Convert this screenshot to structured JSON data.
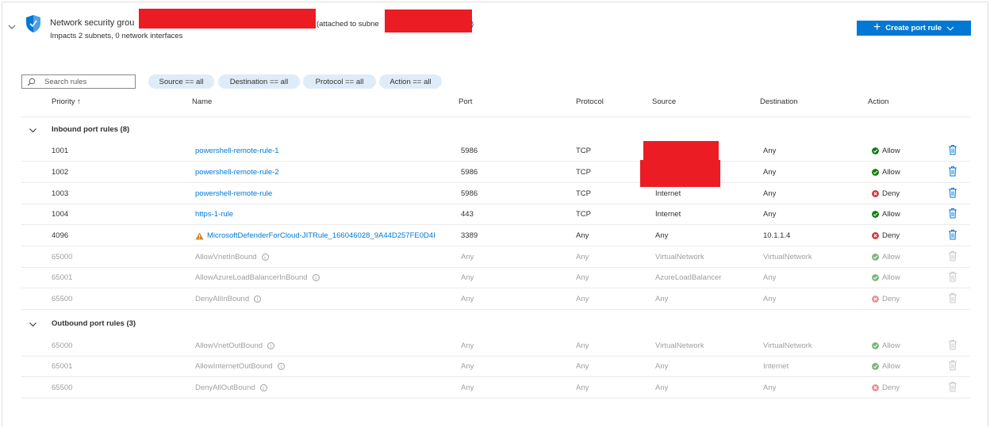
{
  "header": {
    "title": "Network security grou",
    "attached_prefix": "(attached to subne",
    "attached_suffix": ")",
    "subtitle": "Impacts 2 subnets, 0 network interfaces",
    "create_button": "Create port rule"
  },
  "colors": {
    "accent": "#0078d4",
    "allow": "#107c10",
    "deny": "#d13438",
    "pill_bg": "#deecf9",
    "redaction": "#ec1c24"
  },
  "filters": {
    "search_placeholder": "Search rules",
    "pills": [
      "Source == all",
      "Destination == all",
      "Protocol == all",
      "Action == all"
    ]
  },
  "columns": {
    "priority": "Priority ↑",
    "name": "Name",
    "port": "Port",
    "protocol": "Protocol",
    "source": "Source",
    "destination": "Destination",
    "action": "Action"
  },
  "inbound": {
    "label": "Inbound port rules (8)",
    "rows": [
      {
        "priority": "1001",
        "name": "powershell-remote-rule-1",
        "port": "5986",
        "protocol": "TCP",
        "source": "",
        "destination": "Any",
        "action": "Allow"
      },
      {
        "priority": "1002",
        "name": "powershell-remote-rule-2",
        "port": "5986",
        "protocol": "TCP",
        "source": "",
        "destination": "Any",
        "action": "Allow"
      },
      {
        "priority": "1003",
        "name": "powershell-remote-rule",
        "port": "5986",
        "protocol": "TCP",
        "source": "Internet",
        "destination": "Any",
        "action": "Deny"
      },
      {
        "priority": "1004",
        "name": "https-1-rule",
        "port": "443",
        "protocol": "TCP",
        "source": "Internet",
        "destination": "Any",
        "action": "Allow"
      },
      {
        "priority": "4096",
        "name": "MicrosoftDefenderForCloud-JITRule_166046028_9A44D257FE0D4I",
        "port": "3389",
        "protocol": "Any",
        "source": "Any",
        "destination": "10.1.1.4",
        "action": "Deny"
      },
      {
        "priority": "65000",
        "name": "AllowVnetInBound",
        "port": "Any",
        "protocol": "Any",
        "source": "VirtualNetwork",
        "destination": "VirtualNetwork",
        "action": "Allow"
      },
      {
        "priority": "65001",
        "name": "AllowAzureLoadBalancerInBound",
        "port": "Any",
        "protocol": "Any",
        "source": "AzureLoadBalancer",
        "destination": "Any",
        "action": "Allow"
      },
      {
        "priority": "65500",
        "name": "DenyAllInBound",
        "port": "Any",
        "protocol": "Any",
        "source": "Any",
        "destination": "Any",
        "action": "Deny"
      }
    ]
  },
  "outbound": {
    "label": "Outbound port rules (3)",
    "rows": [
      {
        "priority": "65000",
        "name": "AllowVnetOutBound",
        "port": "Any",
        "protocol": "Any",
        "source": "VirtualNetwork",
        "destination": "VirtualNetwork",
        "action": "Allow"
      },
      {
        "priority": "65001",
        "name": "AllowInternetOutBound",
        "port": "Any",
        "protocol": "Any",
        "source": "Any",
        "destination": "Internet",
        "action": "Allow"
      },
      {
        "priority": "65500",
        "name": "DenyAllOutBound",
        "port": "Any",
        "protocol": "Any",
        "source": "Any",
        "destination": "Any",
        "action": "Deny"
      }
    ]
  }
}
